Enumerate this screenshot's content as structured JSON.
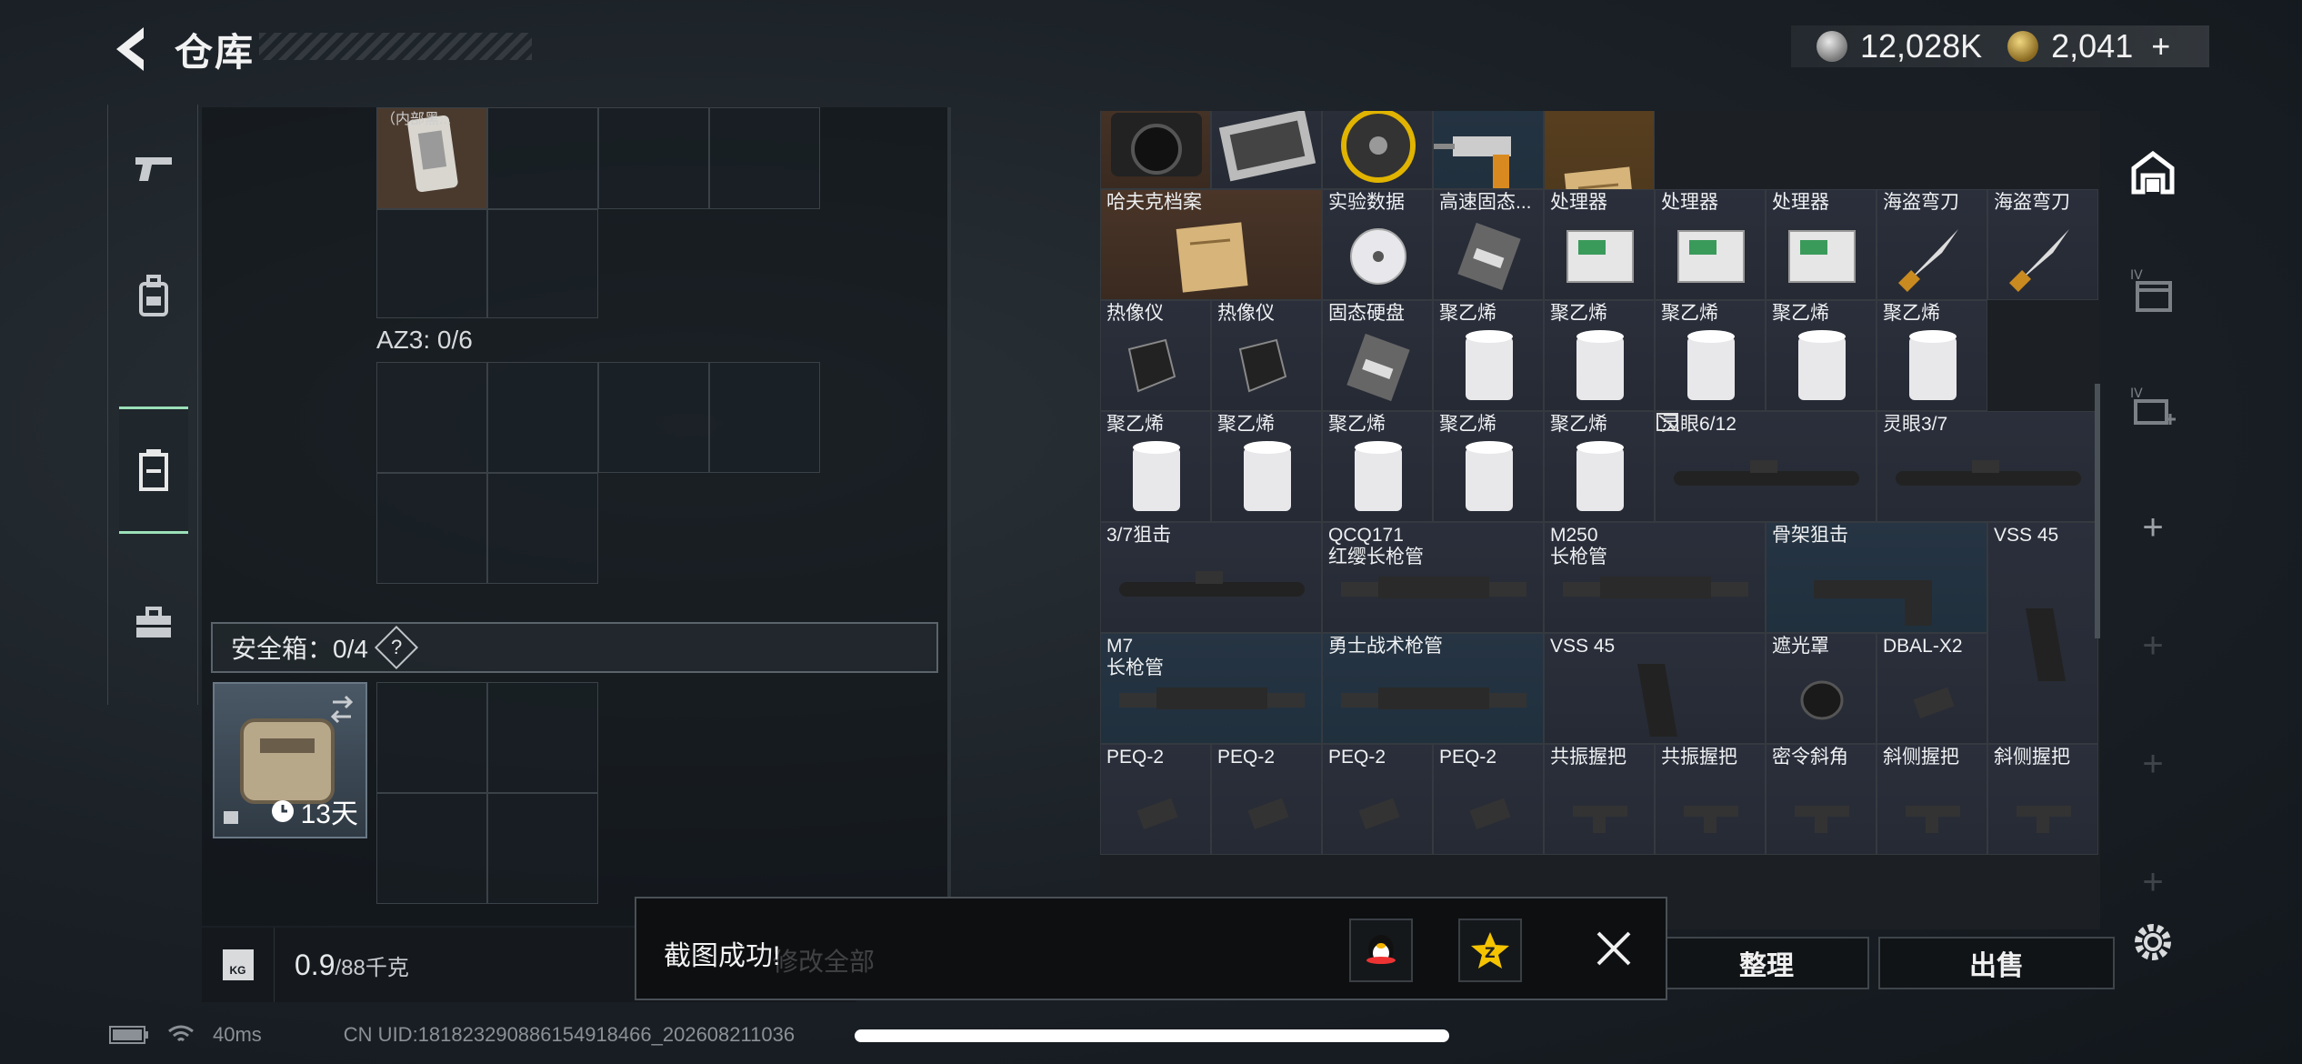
{
  "header": {
    "title": "仓库",
    "currency": [
      {
        "icon": "silver-coin-icon",
        "value": "12,028K"
      },
      {
        "icon": "gold-coin-icon",
        "value": "2,041",
        "plus": "+"
      }
    ]
  },
  "mid": {
    "top_item_label": "（内部黑...",
    "az3_label": "AZ3: 0/6",
    "safebox": {
      "label": "安全箱：0/4",
      "help": "?",
      "days": "13天"
    }
  },
  "weight": {
    "value": "0.9",
    "unit": "/88千克",
    "icon_text": "KG"
  },
  "items": [
    {
      "label": "",
      "rarity": "r-brown",
      "icon": "camera-icon"
    },
    {
      "label": "",
      "rarity": "",
      "icon": "toolkit-icon"
    },
    {
      "label": "",
      "rarity": "",
      "icon": "circular-saw-icon"
    },
    {
      "label": "无线电钻",
      "rarity": "r-blue",
      "icon": "drill-icon"
    },
    {
      "label": "",
      "rarity": "r-gold",
      "icon": "document-icon"
    },
    {
      "label": "哈夫克档案",
      "rarity": "r-brown",
      "icon": "folder-icon"
    },
    {
      "label": "实验数据",
      "rarity": "",
      "icon": "disc-icon"
    },
    {
      "label": "高速固态...",
      "rarity": "",
      "icon": "ssd-icon"
    },
    {
      "label": "处理器",
      "rarity": "",
      "icon": "processor-icon"
    },
    {
      "label": "处理器",
      "rarity": "",
      "icon": "processor-icon"
    },
    {
      "label": "处理器",
      "rarity": "",
      "icon": "processor-icon"
    },
    {
      "label": "海盗弯刀",
      "rarity": "",
      "icon": "knife-icon"
    },
    {
      "label": "海盗弯刀",
      "rarity": "",
      "icon": "knife-icon"
    },
    {
      "label": "热像仪",
      "rarity": "",
      "icon": "thermal-icon"
    },
    {
      "label": "热像仪",
      "rarity": "",
      "icon": "thermal-icon"
    },
    {
      "label": "固态硬盘",
      "rarity": "",
      "icon": "ssd-icon"
    },
    {
      "label": "聚乙烯",
      "rarity": "",
      "icon": "roll-icon"
    },
    {
      "label": "聚乙烯",
      "rarity": "",
      "icon": "roll-icon"
    },
    {
      "label": "聚乙烯",
      "rarity": "",
      "icon": "roll-icon"
    },
    {
      "label": "聚乙烯",
      "rarity": "",
      "icon": "roll-icon"
    },
    {
      "label": "聚乙烯",
      "rarity": "",
      "icon": "roll-icon"
    },
    {
      "label": "聚乙烯",
      "rarity": "",
      "icon": "roll-icon"
    },
    {
      "label": "聚乙烯",
      "rarity": "",
      "icon": "roll-icon"
    },
    {
      "label": "聚乙烯",
      "rarity": "",
      "icon": "roll-icon"
    },
    {
      "label": "聚乙烯",
      "rarity": "",
      "icon": "roll-icon"
    },
    {
      "label": "聚乙烯",
      "rarity": "",
      "icon": "roll-icon"
    },
    {
      "label": "灵眼6/12",
      "rarity": "",
      "icon": "scope-icon"
    },
    {
      "label": "灵眼3/7",
      "rarity": "",
      "icon": "scope-icon"
    },
    {
      "label": "3/7狙击",
      "rarity": "",
      "icon": "scope-icon"
    },
    {
      "label": "QCQ171\n红缨长枪管",
      "rarity": "",
      "icon": "barrel-icon"
    },
    {
      "label": "M250\n长枪管",
      "rarity": "",
      "icon": "barrel-icon"
    },
    {
      "label": "骨架狙击",
      "rarity": "r-blue",
      "icon": "stock-icon"
    },
    {
      "label": "VSS 45",
      "rarity": "",
      "icon": "magazine-icon"
    },
    {
      "label": "M7\n长枪管",
      "rarity": "r-blue",
      "icon": "barrel-icon"
    },
    {
      "label": "勇士战术枪管",
      "rarity": "r-blue",
      "icon": "barrel-icon"
    },
    {
      "label": "VSS 45",
      "rarity": "",
      "icon": "magazine-icon"
    },
    {
      "label": "遮光罩",
      "rarity": "",
      "icon": "hood-icon"
    },
    {
      "label": "DBAL-X2",
      "rarity": "",
      "icon": "laser-icon"
    },
    {
      "label": "PEQ-2",
      "rarity": "",
      "icon": "laser-icon"
    },
    {
      "label": "PEQ-2",
      "rarity": "",
      "icon": "laser-icon"
    },
    {
      "label": "PEQ-2",
      "rarity": "",
      "icon": "laser-icon"
    },
    {
      "label": "PEQ-2",
      "rarity": "",
      "icon": "laser-icon"
    },
    {
      "label": "共振握把",
      "rarity": "",
      "icon": "grip-icon"
    },
    {
      "label": "共振握把",
      "rarity": "",
      "icon": "grip-icon"
    },
    {
      "label": "密令斜角",
      "rarity": "",
      "icon": "grip-icon"
    },
    {
      "label": "斜侧握把",
      "rarity": "",
      "icon": "grip-icon"
    },
    {
      "label": "斜侧握把",
      "rarity": "",
      "icon": "grip-icon"
    }
  ],
  "actions": {
    "sort": "整理",
    "sell": "出售"
  },
  "toast": {
    "text": "截图成功!",
    "under_text": "修改全部"
  },
  "status": {
    "ping": "40ms",
    "uid": "CN UID:181823290886154918466_202608211036"
  }
}
